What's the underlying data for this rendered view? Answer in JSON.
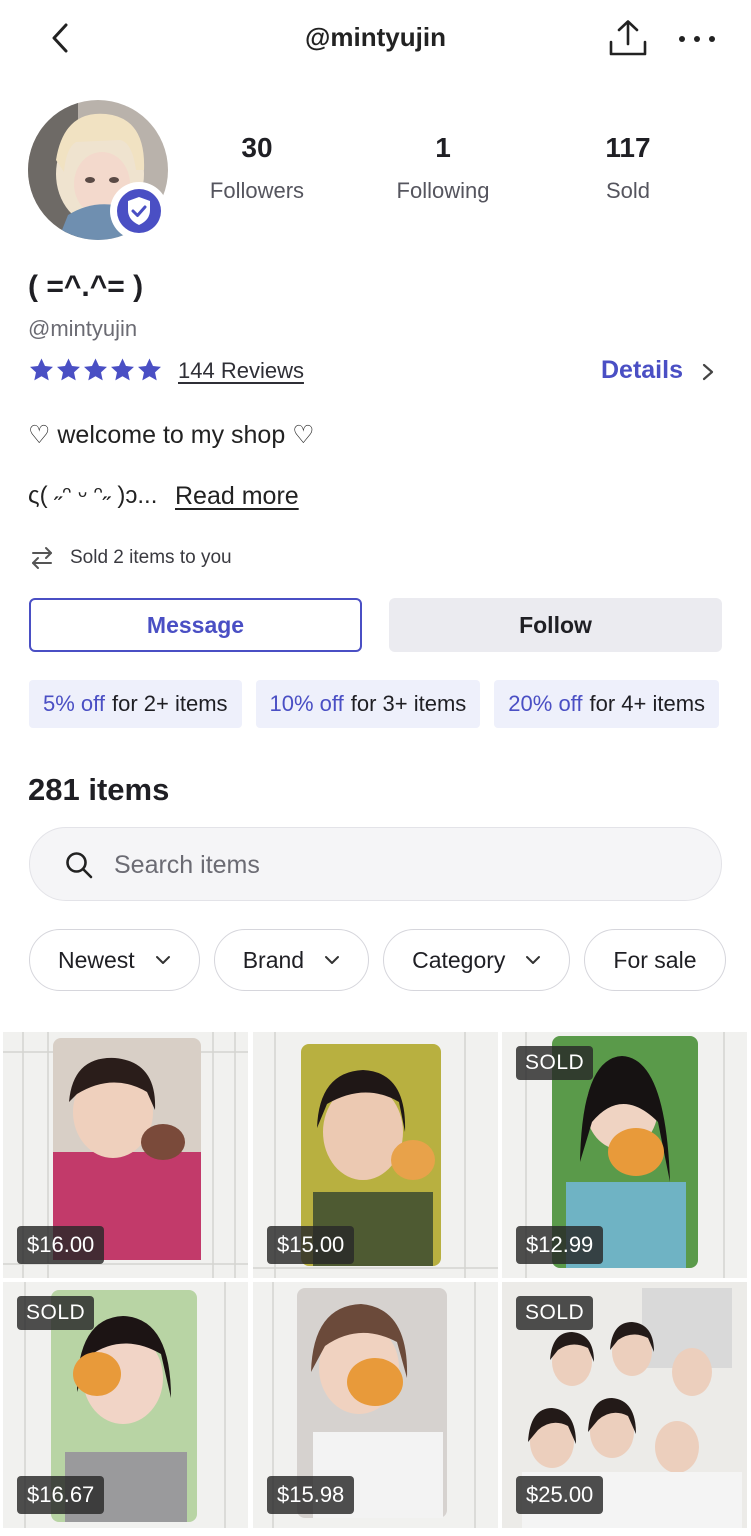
{
  "header": {
    "handle": "@mintyujin",
    "back_icon": "chevron-left-icon",
    "share_icon": "share-upload-icon",
    "more_icon": "more-horizontal-icon"
  },
  "profile": {
    "display_name": "( =^.^= )",
    "username": "@mintyujin",
    "verified": true,
    "stats": [
      {
        "value": "30",
        "label": "Followers"
      },
      {
        "value": "1",
        "label": "Following"
      },
      {
        "value": "117",
        "label": "Sold"
      }
    ],
    "rating_stars": 5,
    "reviews_label": "144 Reviews",
    "details_label": "Details",
    "bio_line1": "♡ welcome to my shop ♡",
    "bio_line2": "ς( ˶ᵔ ᵕ ᵔ˶ )ɔ...",
    "read_more_label": "Read more",
    "sold_to_you": "Sold 2 items to you"
  },
  "actions": {
    "message_label": "Message",
    "follow_label": "Follow"
  },
  "discounts": [
    {
      "pct": "5% off",
      "cond": "for 2+ items"
    },
    {
      "pct": "10% off",
      "cond": "for 3+ items"
    },
    {
      "pct": "20% off",
      "cond": "for 4+ items"
    }
  ],
  "items": {
    "count_label": "281 items",
    "search_placeholder": "Search items",
    "filters": [
      "Newest",
      "Brand",
      "Category",
      "For sale"
    ],
    "grid": [
      {
        "price": "$16.00",
        "sold": false
      },
      {
        "price": "$15.00",
        "sold": false
      },
      {
        "price": "$12.99",
        "sold": true
      },
      {
        "price": "$16.67",
        "sold": true
      },
      {
        "price": "$15.98",
        "sold": false
      },
      {
        "price": "$25.00",
        "sold": true
      }
    ],
    "sold_label": "SOLD"
  },
  "colors": {
    "accent": "#4a4fc4",
    "discount_bg": "#eef0fb",
    "follow_bg": "#ebebf0"
  }
}
